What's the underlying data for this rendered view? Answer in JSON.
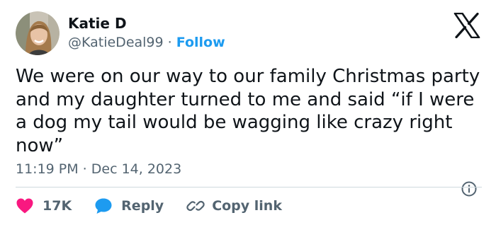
{
  "author": {
    "display_name": "Katie D",
    "handle": "@KatieDeal99",
    "separator": "·",
    "follow_label": "Follow",
    "avatar_icon": "user-avatar-photo"
  },
  "brand": {
    "logo_icon": "x-logo-icon"
  },
  "tweet": {
    "text": "We were on our way to our family Christmas party\nand my daughter turned to me and said “if I were\na dog my tail would be wagging like crazy right\nnow”",
    "timestamp": "11:19 PM · Dec 14, 2023"
  },
  "actions": {
    "like_count": "17K",
    "reply_label": "Reply",
    "copy_label": "Copy link"
  },
  "colors": {
    "accent": "#1d9bf0",
    "like": "#f91880",
    "text_primary": "#0f1419",
    "text_secondary": "#536471",
    "divider": "#cfd9de"
  }
}
